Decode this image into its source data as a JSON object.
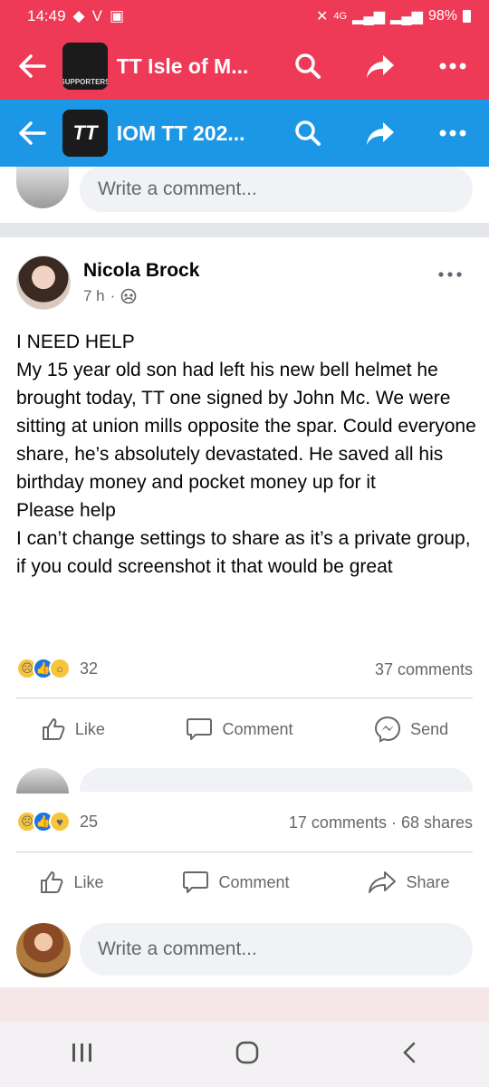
{
  "status": {
    "time": "14:49",
    "battery": "98%",
    "network": "4G"
  },
  "app_headers": [
    {
      "title": "TT Isle of M...",
      "logo_text": "SUPPORTERS",
      "color": "#ee3a57"
    },
    {
      "title": "IOM TT 202...",
      "logo_text": "TT",
      "color": "#1b97e6"
    }
  ],
  "top_comment": {
    "placeholder": "Write a comment..."
  },
  "post": {
    "author": "Nicola Brock",
    "time": "7 h",
    "lines": [
      "I NEED HELP",
      "My 15 year old son had left his new bell helmet he brought today, TT one signed by John Mc. We were sitting at union mills opposite the spar. Could everyone share, he’s absolutely devastated. He saved all his birthday money and pocket money up for it",
      "Please help",
      "I can’t change settings to share as it’s a private group, if you could screenshot it that would be great"
    ],
    "reaction_count": "32",
    "comments_label": "37 comments"
  },
  "actions_inner": {
    "like": "Like",
    "comment": "Comment",
    "send": "Send"
  },
  "outer_post": {
    "reaction_count": "25",
    "stats": "17 comments · 68 shares"
  },
  "actions_outer": {
    "like": "Like",
    "comment": "Comment",
    "share": "Share"
  },
  "bottom_comment": {
    "placeholder": "Write a comment..."
  },
  "colors": {
    "red": "#ee3a57",
    "blue": "#1b97e6",
    "fb_blue": "#1b74e4",
    "grey_text": "#65676b"
  }
}
